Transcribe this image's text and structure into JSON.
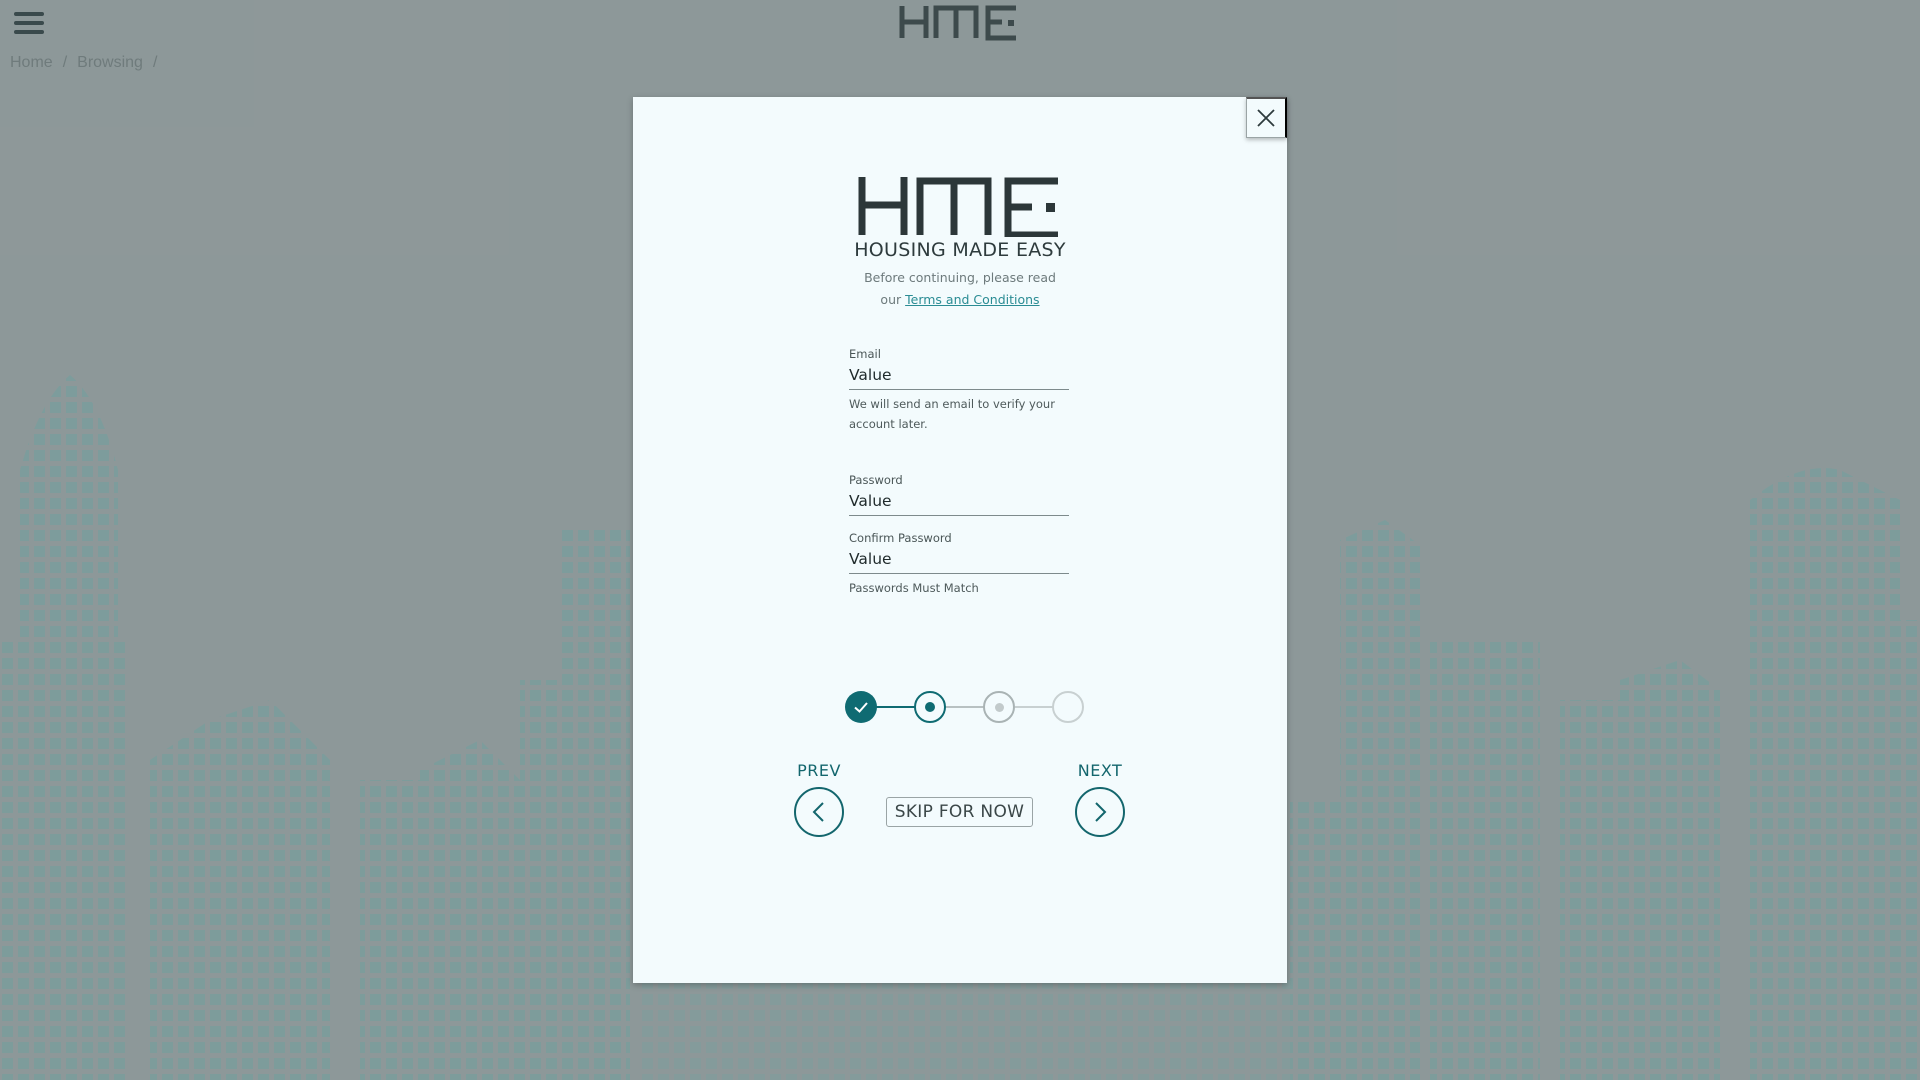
{
  "app": {
    "logo_text": "HME"
  },
  "breadcrumb": [
    {
      "label": "Home"
    },
    {
      "label": "Browsing"
    }
  ],
  "modal": {
    "logo_text": "HME",
    "tagline": "HOUSING MADE EASY",
    "intro_line1": "Before continuing, please read",
    "intro_prefix": "our",
    "terms_link": "Terms and Conditions",
    "email": {
      "label": "Email",
      "value": "Value",
      "helper": "We will send an email to verify your account later."
    },
    "password": {
      "label": "Password",
      "value": "Value"
    },
    "confirm_password": {
      "label": "Confirm Password",
      "value": "Value",
      "helper": "Passwords Must Match"
    },
    "stepper": {
      "total_steps": 4,
      "completed": 1,
      "current": 2
    },
    "nav": {
      "prev_label": "PREV",
      "next_label": "NEXT",
      "skip_label": "SKIP FOR NOW"
    }
  },
  "colors": {
    "accent": "#0f6b72",
    "modal_bg": "#f3fbfd",
    "background": "#8f9a9b",
    "link": "#2a8c94"
  },
  "icons": {
    "menu": "hamburger-icon",
    "close": "close-icon",
    "prev": "chevron-left-icon",
    "next": "chevron-right-icon",
    "step_done": "check-icon"
  }
}
